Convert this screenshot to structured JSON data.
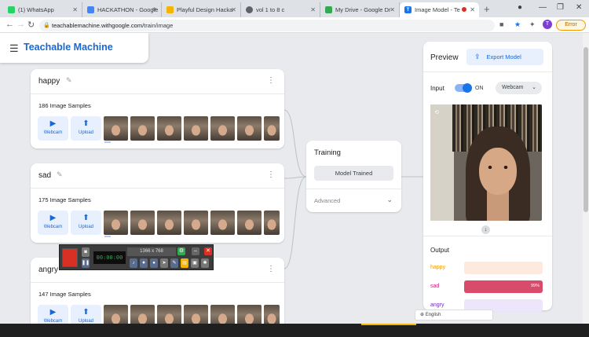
{
  "browser": {
    "tabs": [
      {
        "label": "(1) WhatsApp",
        "icon": "whatsapp-icon",
        "color": "#25d366"
      },
      {
        "label": "HACKATHON - Google",
        "icon": "docs-icon",
        "color": "#4285f4"
      },
      {
        "label": "Playful Design Hacka",
        "icon": "slides-icon",
        "color": "#f4b400"
      },
      {
        "label": "vol 1 to 8 c",
        "icon": "globe-icon",
        "color": "#5f6368"
      },
      {
        "label": "My Drive - Google Dr",
        "icon": "drive-icon",
        "color": "#34a853"
      },
      {
        "label": "Image Model - Te",
        "icon": "teachable-machine-icon",
        "color": "#1a73e8"
      }
    ],
    "url_host": "teachablemachine.withgoogle.com",
    "url_path": "/train/image",
    "error_label": "Error",
    "profile_initial": "T"
  },
  "app": {
    "brand": "Teachable Machine",
    "classes": [
      {
        "name": "happy",
        "samples": "186 Image Samples"
      },
      {
        "name": "sad",
        "samples": "175 Image Samples"
      },
      {
        "name": "angry",
        "samples": "147 Image Samples"
      }
    ],
    "webcam_label": "Webcam",
    "upload_label": "Upload",
    "training": {
      "title": "Training",
      "button": "Model Trained",
      "advanced": "Advanced"
    },
    "preview": {
      "title": "Preview",
      "export": "Export Model",
      "input_label": "Input",
      "toggle_state": "ON",
      "camera": "Webcam",
      "output_label": "Output",
      "outputs": [
        {
          "label": "happy",
          "color": "#f29900",
          "bg": "#fde9dd",
          "fill": "#f7c9ad",
          "value": 0
        },
        {
          "label": "sad",
          "color": "#d01884",
          "bg": "#fad2da",
          "fill": "#d84b6b",
          "value": 100,
          "pct_text": "99%"
        },
        {
          "label": "angry",
          "color": "#7627bb",
          "bg": "#ece5fb",
          "fill": "#c5b1f0",
          "value": 0
        }
      ]
    },
    "language": "English"
  },
  "recorder": {
    "timer": "00:00:00",
    "size": "1366 x 768"
  }
}
